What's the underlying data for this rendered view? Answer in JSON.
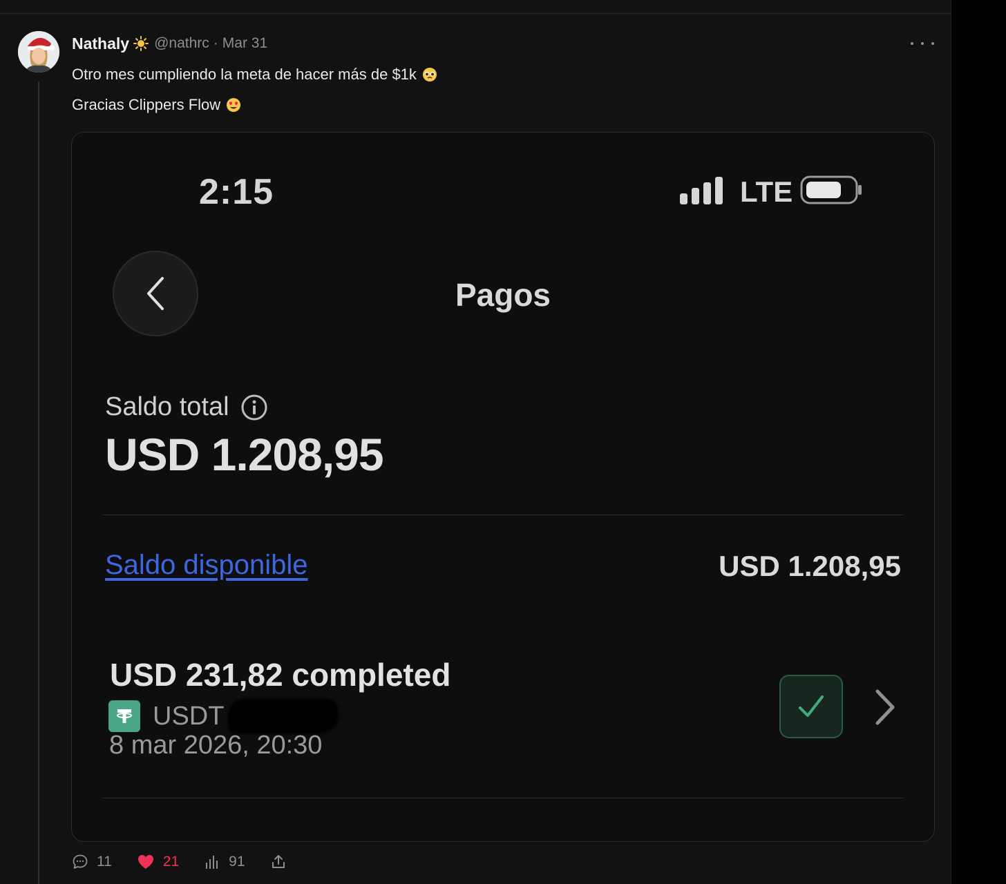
{
  "post": {
    "author_name": "Nathaly",
    "handle": "@nathrc",
    "separator": "·",
    "date": "Mar 31",
    "text_line1": "Otro mes cumpliendo la meta de hacer más de $1k",
    "text_line2": "Gracias Clippers Flow",
    "badge_icon": "sun-icon",
    "emoji_line1": "pleading-face-emoji",
    "emoji_line2": "heart-eyes-emoji"
  },
  "screenshot": {
    "status_time": "2:15",
    "network": "LTE",
    "title": "Pagos",
    "balance_label": "Saldo total",
    "balance_value": "USD 1.208,95",
    "available_label": "Saldo disponible",
    "available_value": "USD 1.208,95",
    "transaction": {
      "amount": "USD 231,82 completed",
      "currency": "USDT",
      "date": "8 mar 2026, 20:30"
    },
    "colors": {
      "link": "#3e66e0",
      "usdt": "#4aa684",
      "check": "#3fae7c"
    }
  },
  "actions": {
    "replies": "11",
    "likes": "21",
    "views": "91"
  },
  "colors": {
    "like": "#f0325b",
    "muted": "#8b8f94"
  }
}
